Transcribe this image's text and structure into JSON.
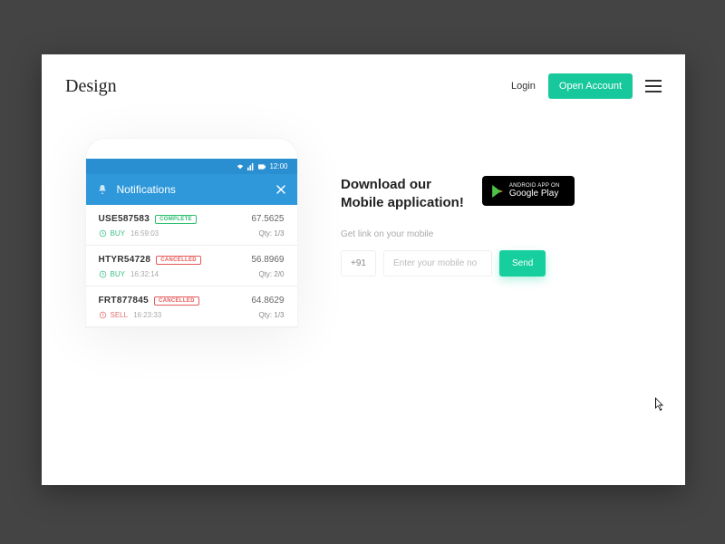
{
  "header": {
    "logo": "Design",
    "login": "Login",
    "open_account": "Open Account"
  },
  "phone": {
    "status_time": "12:00",
    "title": "Notifications",
    "rows": [
      {
        "id": "USE587583",
        "status": "COMPLETE",
        "status_kind": "complete",
        "price": "67.5625",
        "side": "BUY",
        "side_color": "#3bbf88",
        "time": "16:59:03",
        "qty": "Qty: 1/3"
      },
      {
        "id": "HTYR54728",
        "status": "CANCELLED",
        "status_kind": "cancelled",
        "price": "56.8969",
        "side": "BUY",
        "side_color": "#3bbf88",
        "time": "16:32:14",
        "qty": "Qty: 2/0"
      },
      {
        "id": "FRT877845",
        "status": "CANCELLED",
        "status_kind": "cancelled",
        "price": "64.8629",
        "side": "SELL",
        "side_color": "#e26f6f",
        "time": "16:23:33",
        "qty": "Qty: 1/3"
      }
    ]
  },
  "promo": {
    "heading_line1": "Download our",
    "heading_line2": "Mobile application!",
    "gplay_top": "ANDROID APP ON",
    "gplay_bottom": "Google Play",
    "sub": "Get link on your mobile",
    "country_code": "+91",
    "placeholder": "Enter your mobile no",
    "send": "Send"
  }
}
